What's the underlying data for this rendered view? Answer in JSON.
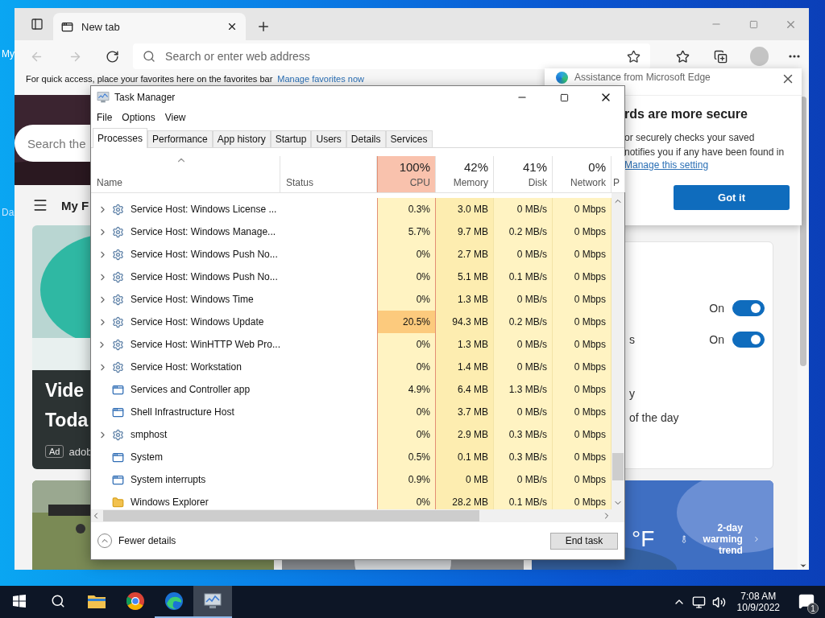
{
  "desktop": {
    "icons": [
      {
        "label": "My"
      },
      {
        "label": "Da"
      }
    ]
  },
  "browser": {
    "tabs": [
      {
        "title": "New tab",
        "selected": true
      }
    ],
    "back": {
      "disabled": true
    },
    "forward": {
      "disabled": true
    },
    "address": {
      "placeholder": "Search or enter web address"
    },
    "favorites_bar": {
      "text": "For quick access, place your favorites here on the favorites bar",
      "link": "Manage favorites now"
    },
    "page": {
      "search": {
        "placeholder": "Search the"
      },
      "feed_title": "My F",
      "card": {
        "headline": [
          "Vide",
          "Toda"
        ],
        "ad_badge": "Ad",
        "source": "adob"
      },
      "settings_panel": {
        "toggles": [
          {
            "state_text": "On",
            "on": true
          },
          {
            "label": "s",
            "state_text": "On",
            "on": true
          }
        ],
        "texts": [
          "y",
          "of the day"
        ]
      },
      "weather": {
        "unit": "°F",
        "trend": "2-day warming trend"
      }
    }
  },
  "popup": {
    "header": "Assistance from Microsoft Edge",
    "title": "rds are more secure",
    "lines": [
      "or securely checks your saved",
      "notifies you if any have been found in"
    ],
    "link": "Manage this setting",
    "button": "Got it"
  },
  "task_manager": {
    "title": "Task Manager",
    "menu": [
      "File",
      "Options",
      "View"
    ],
    "tabs": [
      {
        "label": "Processes",
        "selected": true
      },
      {
        "label": "Performance",
        "selected": false
      },
      {
        "label": "App history",
        "selected": false
      },
      {
        "label": "Startup",
        "selected": false
      },
      {
        "label": "Users",
        "selected": false
      },
      {
        "label": "Details",
        "selected": false
      },
      {
        "label": "Services",
        "selected": false
      }
    ],
    "columns": [
      {
        "label": "Name",
        "sorted": true,
        "hot": false
      },
      {
        "label": "Status",
        "sorted": false,
        "hot": false
      },
      {
        "label": "CPU",
        "usage": "100%",
        "sorted": false,
        "hot": true
      },
      {
        "label": "Memory",
        "usage": "42%",
        "sorted": false,
        "hot": false
      },
      {
        "label": "Disk",
        "usage": "41%",
        "sorted": false,
        "hot": false
      },
      {
        "label": "Network",
        "usage": "0%",
        "sorted": false,
        "hot": false
      },
      {
        "label": "P",
        "sorted": false,
        "hot": false
      }
    ],
    "rows": [
      {
        "name": "Service Host: Windows License ...",
        "kind": "service",
        "expandable": true,
        "cpu": "0.3%",
        "memory": "3.0 MB",
        "disk": "0 MB/s",
        "network": "0 Mbps",
        "highlight": false
      },
      {
        "name": "Service Host: Windows Manage...",
        "kind": "service",
        "expandable": true,
        "cpu": "5.7%",
        "memory": "9.7 MB",
        "disk": "0.2 MB/s",
        "network": "0 Mbps",
        "highlight": false
      },
      {
        "name": "Service Host: Windows Push No...",
        "kind": "service",
        "expandable": true,
        "cpu": "0%",
        "memory": "2.7 MB",
        "disk": "0 MB/s",
        "network": "0 Mbps",
        "highlight": false
      },
      {
        "name": "Service Host: Windows Push No...",
        "kind": "service",
        "expandable": true,
        "cpu": "0%",
        "memory": "5.1 MB",
        "disk": "0.1 MB/s",
        "network": "0 Mbps",
        "highlight": false
      },
      {
        "name": "Service Host: Windows Time",
        "kind": "service",
        "expandable": true,
        "cpu": "0%",
        "memory": "1.3 MB",
        "disk": "0 MB/s",
        "network": "0 Mbps",
        "highlight": false
      },
      {
        "name": "Service Host: Windows Update",
        "kind": "service",
        "expandable": true,
        "cpu": "20.5%",
        "memory": "94.3 MB",
        "disk": "0.2 MB/s",
        "network": "0 Mbps",
        "highlight": true
      },
      {
        "name": "Service Host: WinHTTP Web Pro...",
        "kind": "service",
        "expandable": true,
        "cpu": "0%",
        "memory": "1.3 MB",
        "disk": "0 MB/s",
        "network": "0 Mbps",
        "highlight": false
      },
      {
        "name": "Service Host: Workstation",
        "kind": "service",
        "expandable": true,
        "cpu": "0%",
        "memory": "1.4 MB",
        "disk": "0 MB/s",
        "network": "0 Mbps",
        "highlight": false
      },
      {
        "name": "Services and Controller app",
        "kind": "app",
        "expandable": false,
        "cpu": "4.9%",
        "memory": "6.4 MB",
        "disk": "1.3 MB/s",
        "network": "0 Mbps",
        "highlight": false
      },
      {
        "name": "Shell Infrastructure Host",
        "kind": "app",
        "expandable": false,
        "cpu": "0%",
        "memory": "3.7 MB",
        "disk": "0 MB/s",
        "network": "0 Mbps",
        "highlight": false
      },
      {
        "name": "smphost",
        "kind": "service",
        "expandable": true,
        "cpu": "0%",
        "memory": "2.9 MB",
        "disk": "0.3 MB/s",
        "network": "0 Mbps",
        "highlight": false
      },
      {
        "name": "System",
        "kind": "app",
        "expandable": false,
        "cpu": "0.5%",
        "memory": "0.1 MB",
        "disk": "0.3 MB/s",
        "network": "0 Mbps",
        "highlight": false
      },
      {
        "name": "System interrupts",
        "kind": "app",
        "expandable": false,
        "cpu": "0.9%",
        "memory": "0 MB",
        "disk": "0 MB/s",
        "network": "0 Mbps",
        "highlight": false
      },
      {
        "name": "Windows Explorer",
        "kind": "folder",
        "expandable": false,
        "cpu": "0%",
        "memory": "28.2 MB",
        "disk": "0.1 MB/s",
        "network": "0 Mbps",
        "highlight": false
      }
    ],
    "fewer_details": "Fewer details",
    "end_task": "End task"
  },
  "taskbar": {
    "apps": [
      {
        "kind": "explorer",
        "running": false,
        "selected": false
      },
      {
        "kind": "chrome",
        "running": false,
        "selected": false
      },
      {
        "kind": "edge",
        "running": true,
        "selected": false
      },
      {
        "kind": "taskmgr",
        "running": true,
        "selected": true
      }
    ],
    "time": "7:08 AM",
    "date": "10/9/2022",
    "notifications": "1"
  }
}
